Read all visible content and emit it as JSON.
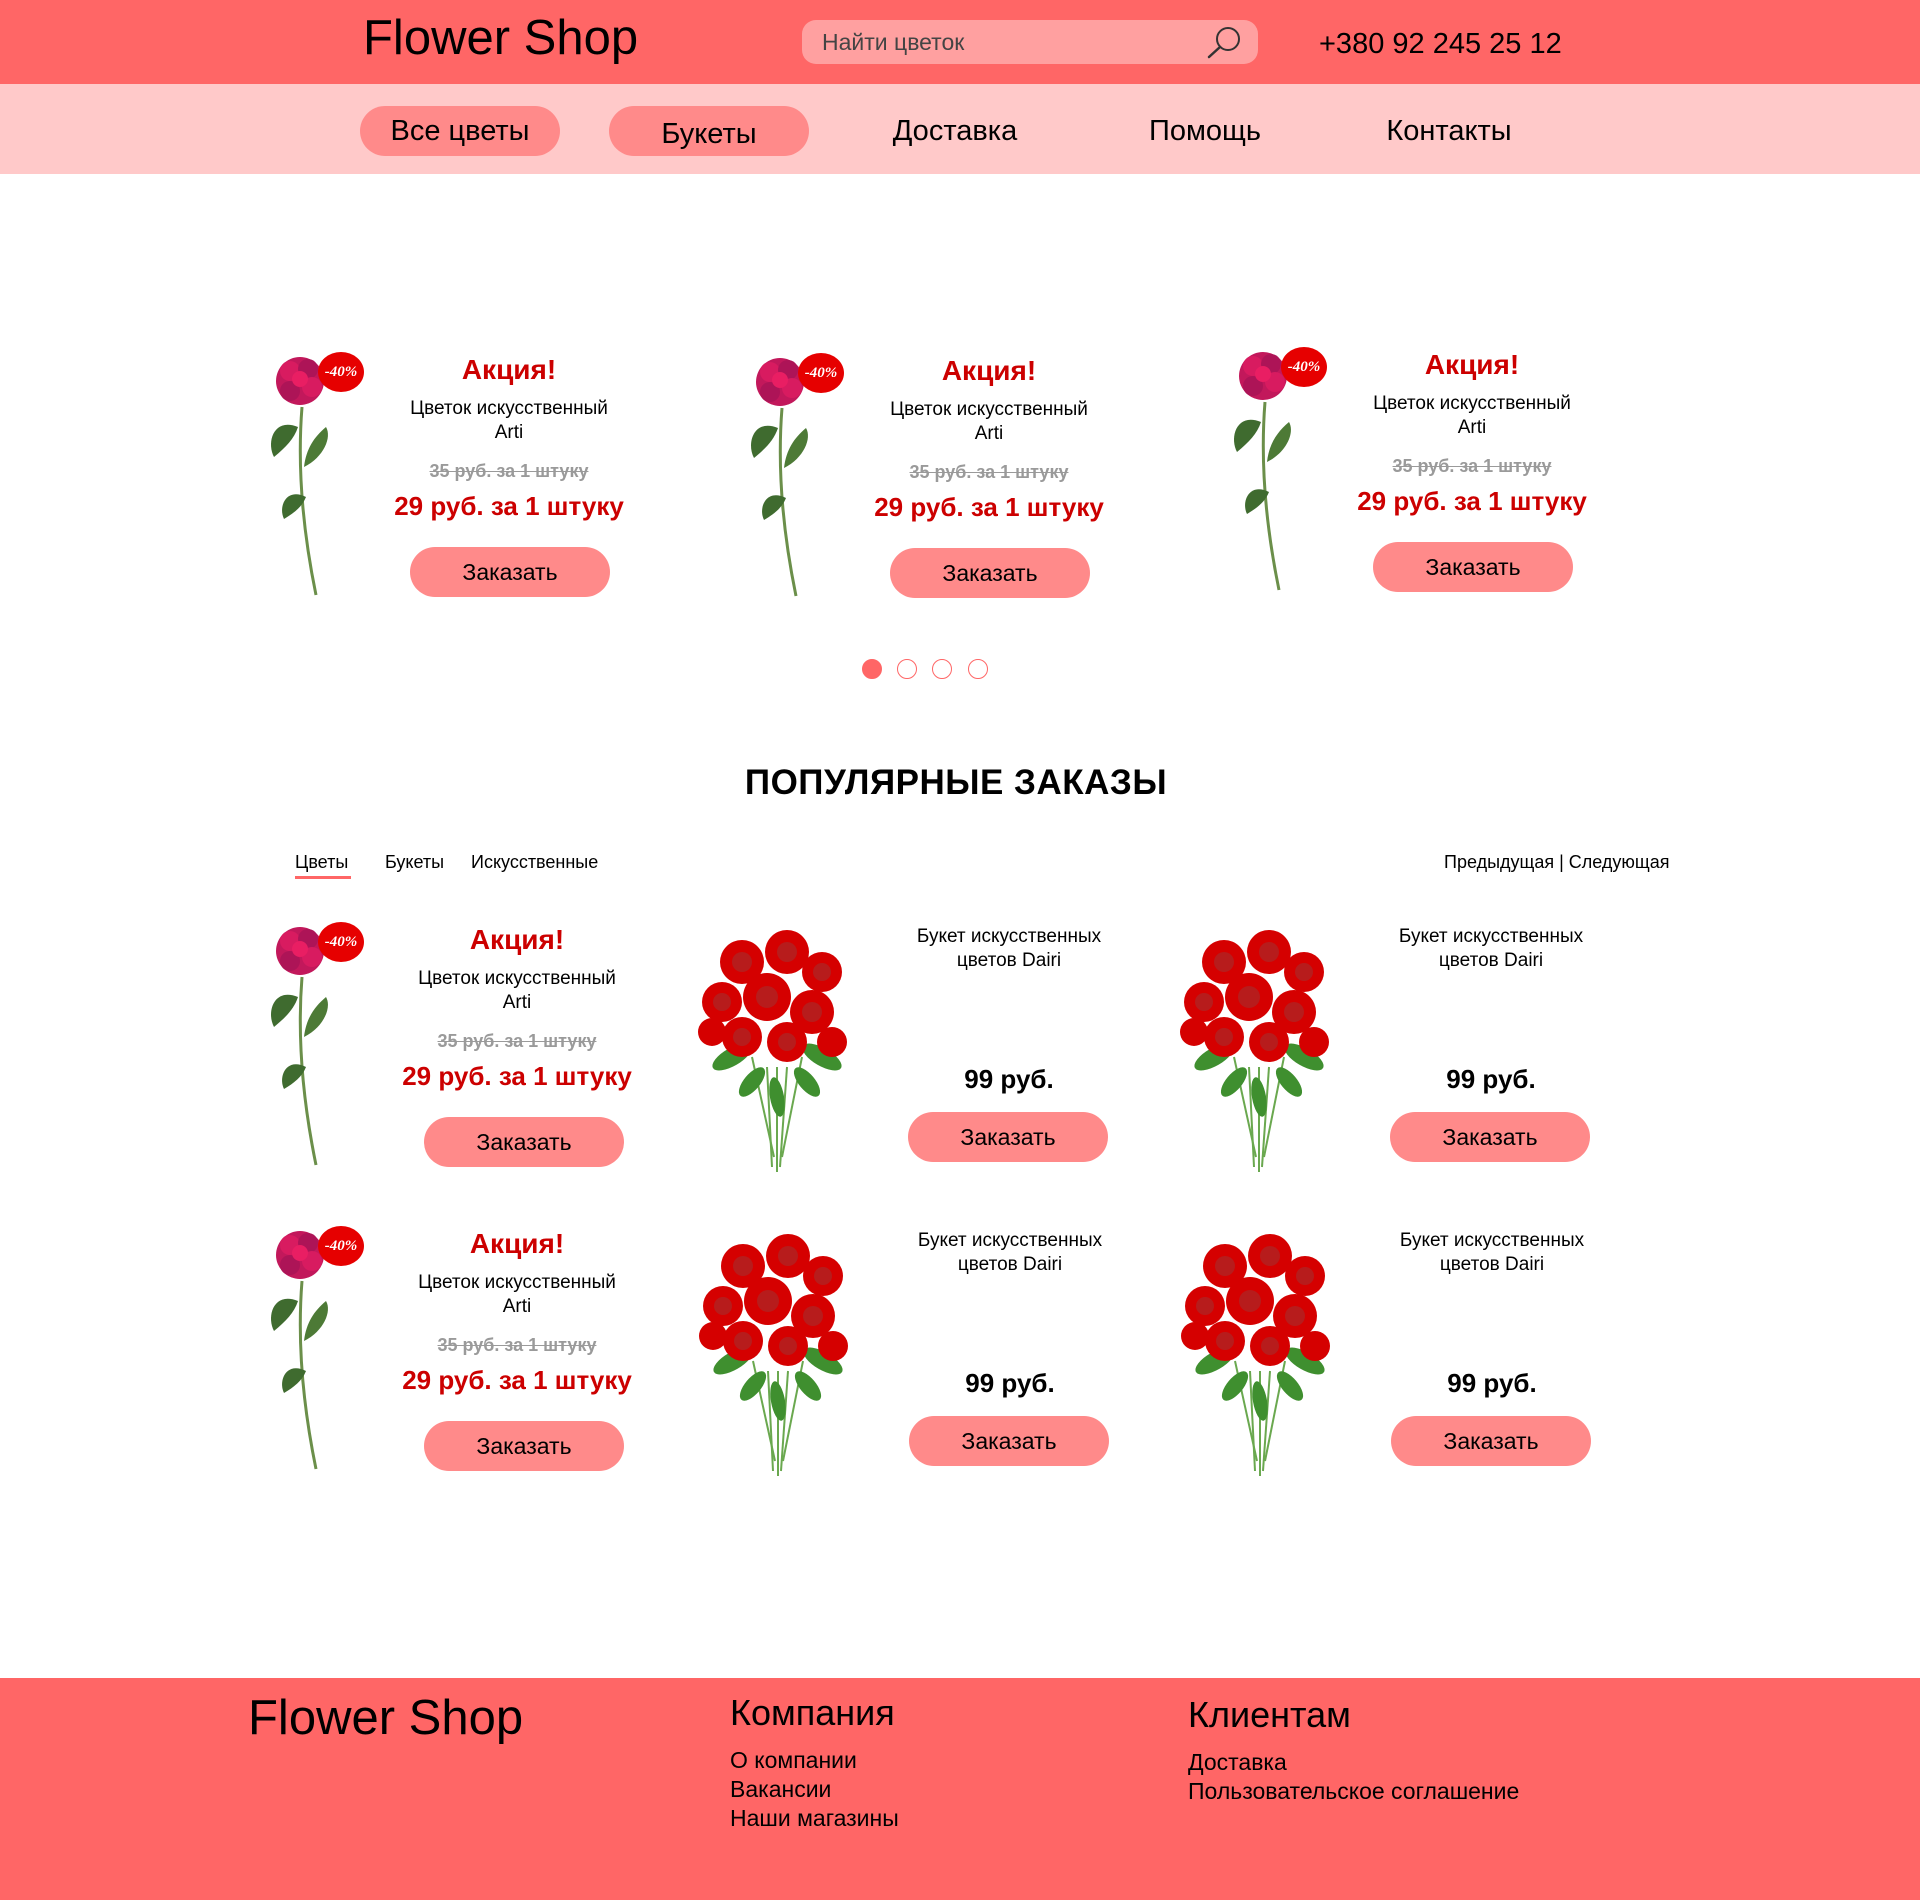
{
  "header": {
    "logo": "Flower Shop",
    "search_placeholder": "Найти цветок",
    "phone": "+380 92 245 25 12"
  },
  "nav": {
    "items": [
      {
        "label": "Все цветы"
      },
      {
        "label": "Букеты"
      },
      {
        "label": "Доставка"
      },
      {
        "label": "Помощь"
      },
      {
        "label": "Контакты"
      }
    ]
  },
  "slider": {
    "cards": [
      {
        "badge": "-40%",
        "title": "Акция!",
        "name": "Цветок искусственный Arti",
        "old_price": "35 руб. за 1 штуку",
        "new_price": "29 руб. за 1 штуку",
        "button": "Заказать"
      },
      {
        "badge": "-40%",
        "title": "Акция!",
        "name": "Цветок искусственный Arti",
        "old_price": "35 руб. за 1 штуку",
        "new_price": "29 руб. за 1 штуку",
        "button": "Заказать"
      },
      {
        "badge": "-40%",
        "title": "Акция!",
        "name": "Цветок искусственный Arti",
        "old_price": "35 руб. за 1 штуку",
        "new_price": "29 руб. за 1 штуку",
        "button": "Заказать"
      }
    ],
    "dots_total": 4,
    "dots_active": 1
  },
  "popular": {
    "title": "ПОПУЛЯРНЫЕ ЗАКАЗЫ",
    "tabs": [
      "Цветы",
      "Букеты",
      "Искусственные"
    ],
    "active_tab": "Цветы",
    "prev": "Предыдущая",
    "separator": "|",
    "next": "Следующая",
    "rows": [
      {
        "promo": {
          "badge": "-40%",
          "title": "Акция!",
          "name": "Цветок искусственный Arti",
          "old_price": "35 руб. за 1 штуку",
          "new_price": "29 руб. за 1 штуку",
          "button": "Заказать"
        },
        "bouquets": [
          {
            "name": "Букет искусственных цветов Dairi",
            "price": "99 руб.",
            "button": "Заказать"
          },
          {
            "name": "Букет искусственных цветов Dairi",
            "price": "99 руб.",
            "button": "Заказать"
          }
        ]
      },
      {
        "promo": {
          "badge": "-40%",
          "title": "Акция!",
          "name": "Цветок искусственный Arti",
          "old_price": "35 руб. за 1 штуку",
          "new_price": "29 руб. за 1 штуку",
          "button": "Заказать"
        },
        "bouquets": [
          {
            "name": "Букет искусственных цветов Dairi",
            "price": "99 руб.",
            "button": "Заказать"
          },
          {
            "name": "Букет искусственных цветов Dairi",
            "price": "99 руб.",
            "button": "Заказать"
          }
        ]
      }
    ]
  },
  "footer": {
    "logo": "Flower Shop",
    "company": {
      "title": "Компания",
      "links": [
        "О компании",
        "Вакансии",
        "Наши магазины"
      ]
    },
    "clients": {
      "title": "Клиентам",
      "links": [
        "Доставка",
        "Пользовательское соглашение"
      ]
    }
  },
  "colors": {
    "header_bg": "#ff6666",
    "nav_bg": "#ffc9c9",
    "pill_bg": "#ff8a8a",
    "promo_red": "#cc0000",
    "badge_red": "#e60000"
  }
}
